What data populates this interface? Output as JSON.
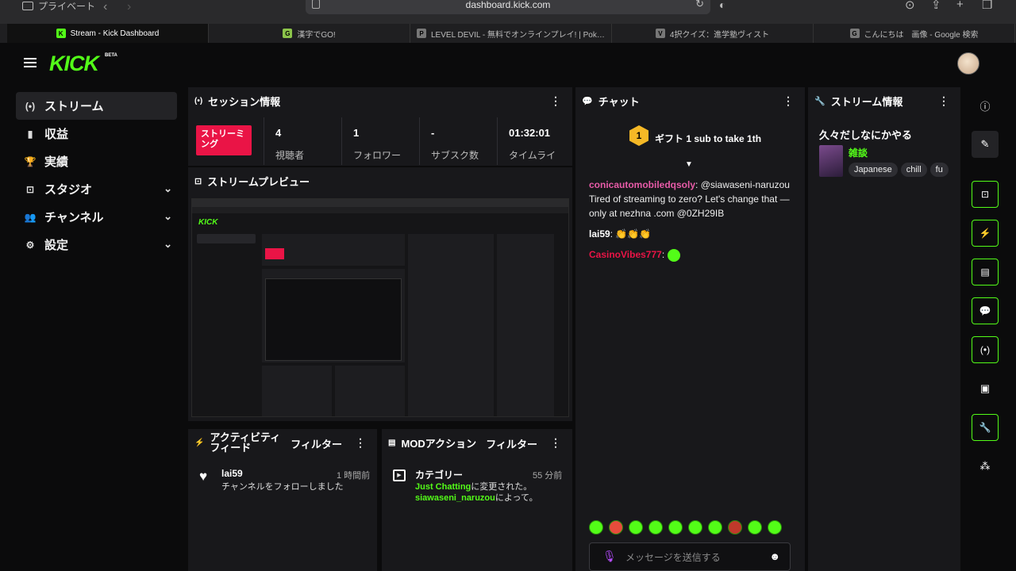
{
  "browser": {
    "private_label": "プライベート",
    "url": "dashboard.kick.com",
    "tabs": [
      {
        "title": "Stream - Kick Dashboard",
        "favicon": "K",
        "color": "#53fc18",
        "active": true
      },
      {
        "title": "漢字でGO!",
        "favicon": "G",
        "color": "#8bc34a",
        "active": false
      },
      {
        "title": "LEVEL DEVIL - 無料でオンラインプレイ! | Poki (…",
        "favicon": "P",
        "color": "#777",
        "active": false
      },
      {
        "title": "4択クイズ：進学塾ヴィスト",
        "favicon": "V",
        "color": "#777",
        "active": false
      },
      {
        "title": "こんにちは　画像 - Google 検索",
        "favicon": "G",
        "color": "#777",
        "active": false
      }
    ]
  },
  "brand": {
    "logo": "KICK",
    "beta": "BETA"
  },
  "sidebar": {
    "items": [
      {
        "label": "ストリーム",
        "icon": "broadcast-icon",
        "glyph": "(•)",
        "active": true,
        "expandable": false
      },
      {
        "label": "収益",
        "icon": "chart-icon",
        "glyph": "▮",
        "active": false,
        "expandable": false
      },
      {
        "label": "実績",
        "icon": "trophy-icon",
        "glyph": "🏆",
        "active": false,
        "expandable": false
      },
      {
        "label": "スタジオ",
        "icon": "studio-icon",
        "glyph": "⊡",
        "active": false,
        "expandable": true
      },
      {
        "label": "チャンネル",
        "icon": "channel-icon",
        "glyph": "👥",
        "active": false,
        "expandable": true
      },
      {
        "label": "設定",
        "icon": "settings-icon",
        "glyph": "⚙",
        "active": false,
        "expandable": true
      }
    ]
  },
  "session": {
    "title": "セッション情報",
    "live_label": "ストリーミング",
    "stats": [
      {
        "value": "4",
        "label": "視聴者"
      },
      {
        "value": "1",
        "label": "フォロワー"
      },
      {
        "value": "-",
        "label": "サブスク数"
      },
      {
        "value": "01:32:01",
        "label": "タイムライ"
      }
    ]
  },
  "preview": {
    "title": "ストリームプレビュー"
  },
  "activity": {
    "title": "アクティビティフィード",
    "filter": "フィルター",
    "items": [
      {
        "user": "lai59",
        "time": "1 時間前",
        "text": "チャンネルをフォローしました"
      }
    ]
  },
  "modaction": {
    "title": "MODアクション",
    "filter": "フィルター",
    "items": [
      {
        "title": "カテゴリー",
        "time": "55 分前",
        "category": "Just Chatting",
        "changed": "に変更された。",
        "user": "siawaseni_naruzou",
        "by": "によって。"
      }
    ]
  },
  "chat": {
    "title": "チャット",
    "gift_text": "ギフト 1 sub to take 1th",
    "messages": [
      {
        "user": "conicautomobiledqsoly",
        "color": "#e85ba8",
        "text": "@siawaseni-naruzou Tired of streaming to zero? Let's change that — only at nezhna .com @0ZH29IB"
      },
      {
        "user": "lai59",
        "color": "#ffffff",
        "text": "👏👏👏"
      },
      {
        "user": "CasinoVibes777",
        "color": "#ea1446",
        "text": ""
      }
    ],
    "input_placeholder": "メッセージを送信する"
  },
  "stream_info": {
    "title": "ストリーム情報",
    "stream_title": "久々だしなにかやる",
    "category": "雑談",
    "tags": [
      "Japanese",
      "chill",
      "fu"
    ]
  },
  "colors": {
    "accent": "#53fc18",
    "live": "#ea1446",
    "panel": "#18181b",
    "bg": "#0b0b0c"
  }
}
